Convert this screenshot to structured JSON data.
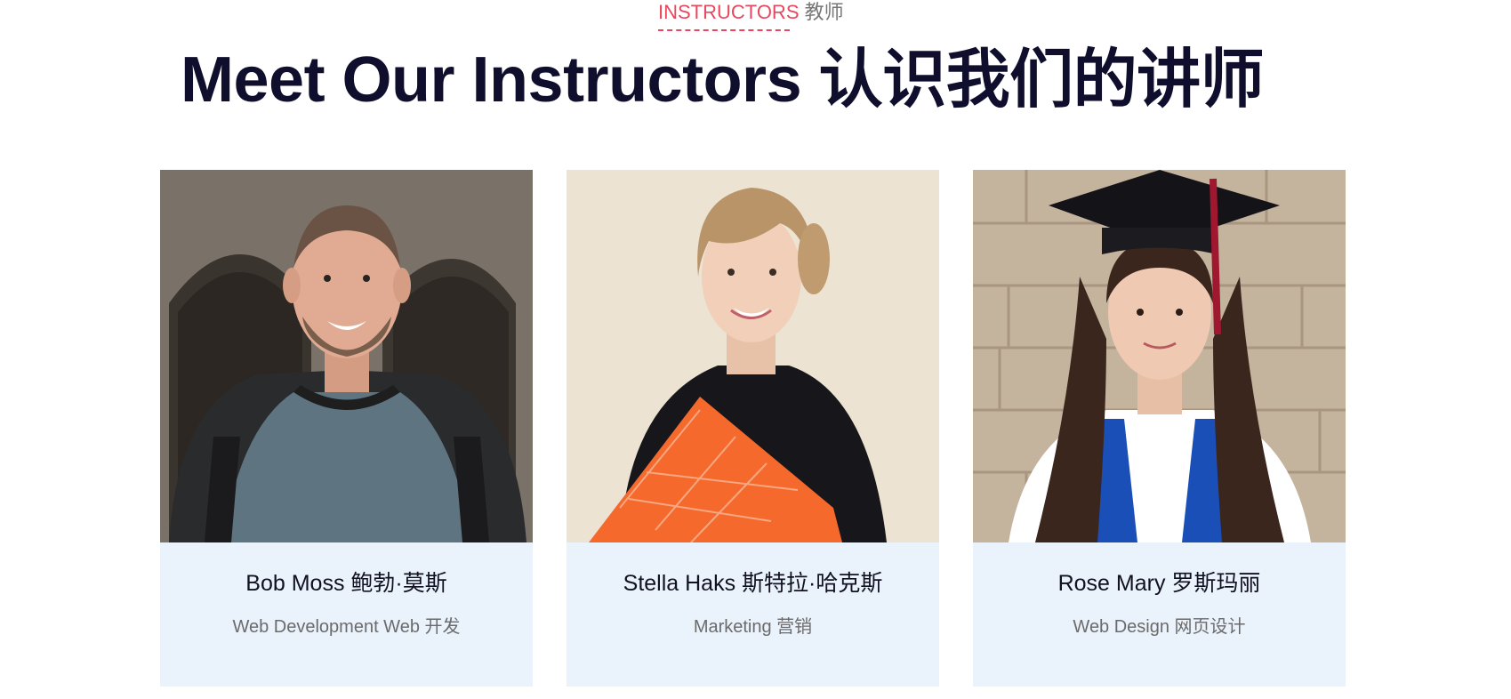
{
  "section": {
    "eyebrow_en": "INSTRUCTORS",
    "eyebrow_zh": "教师",
    "title": "Meet Our Instructors 认识我们的讲师"
  },
  "colors": {
    "accent": "#e8485f",
    "heading": "#0f0f2d",
    "card_bg": "#eaf2fc",
    "role_text": "#6b6b6b"
  },
  "instructors": [
    {
      "name": "Bob Moss 鲍勃·莫斯",
      "role": "Web Development Web 开发"
    },
    {
      "name": "Stella Haks 斯特拉·哈克斯",
      "role": "Marketing 营销"
    },
    {
      "name": "Rose Mary 罗斯玛丽",
      "role": "Web Design 网页设计"
    }
  ]
}
